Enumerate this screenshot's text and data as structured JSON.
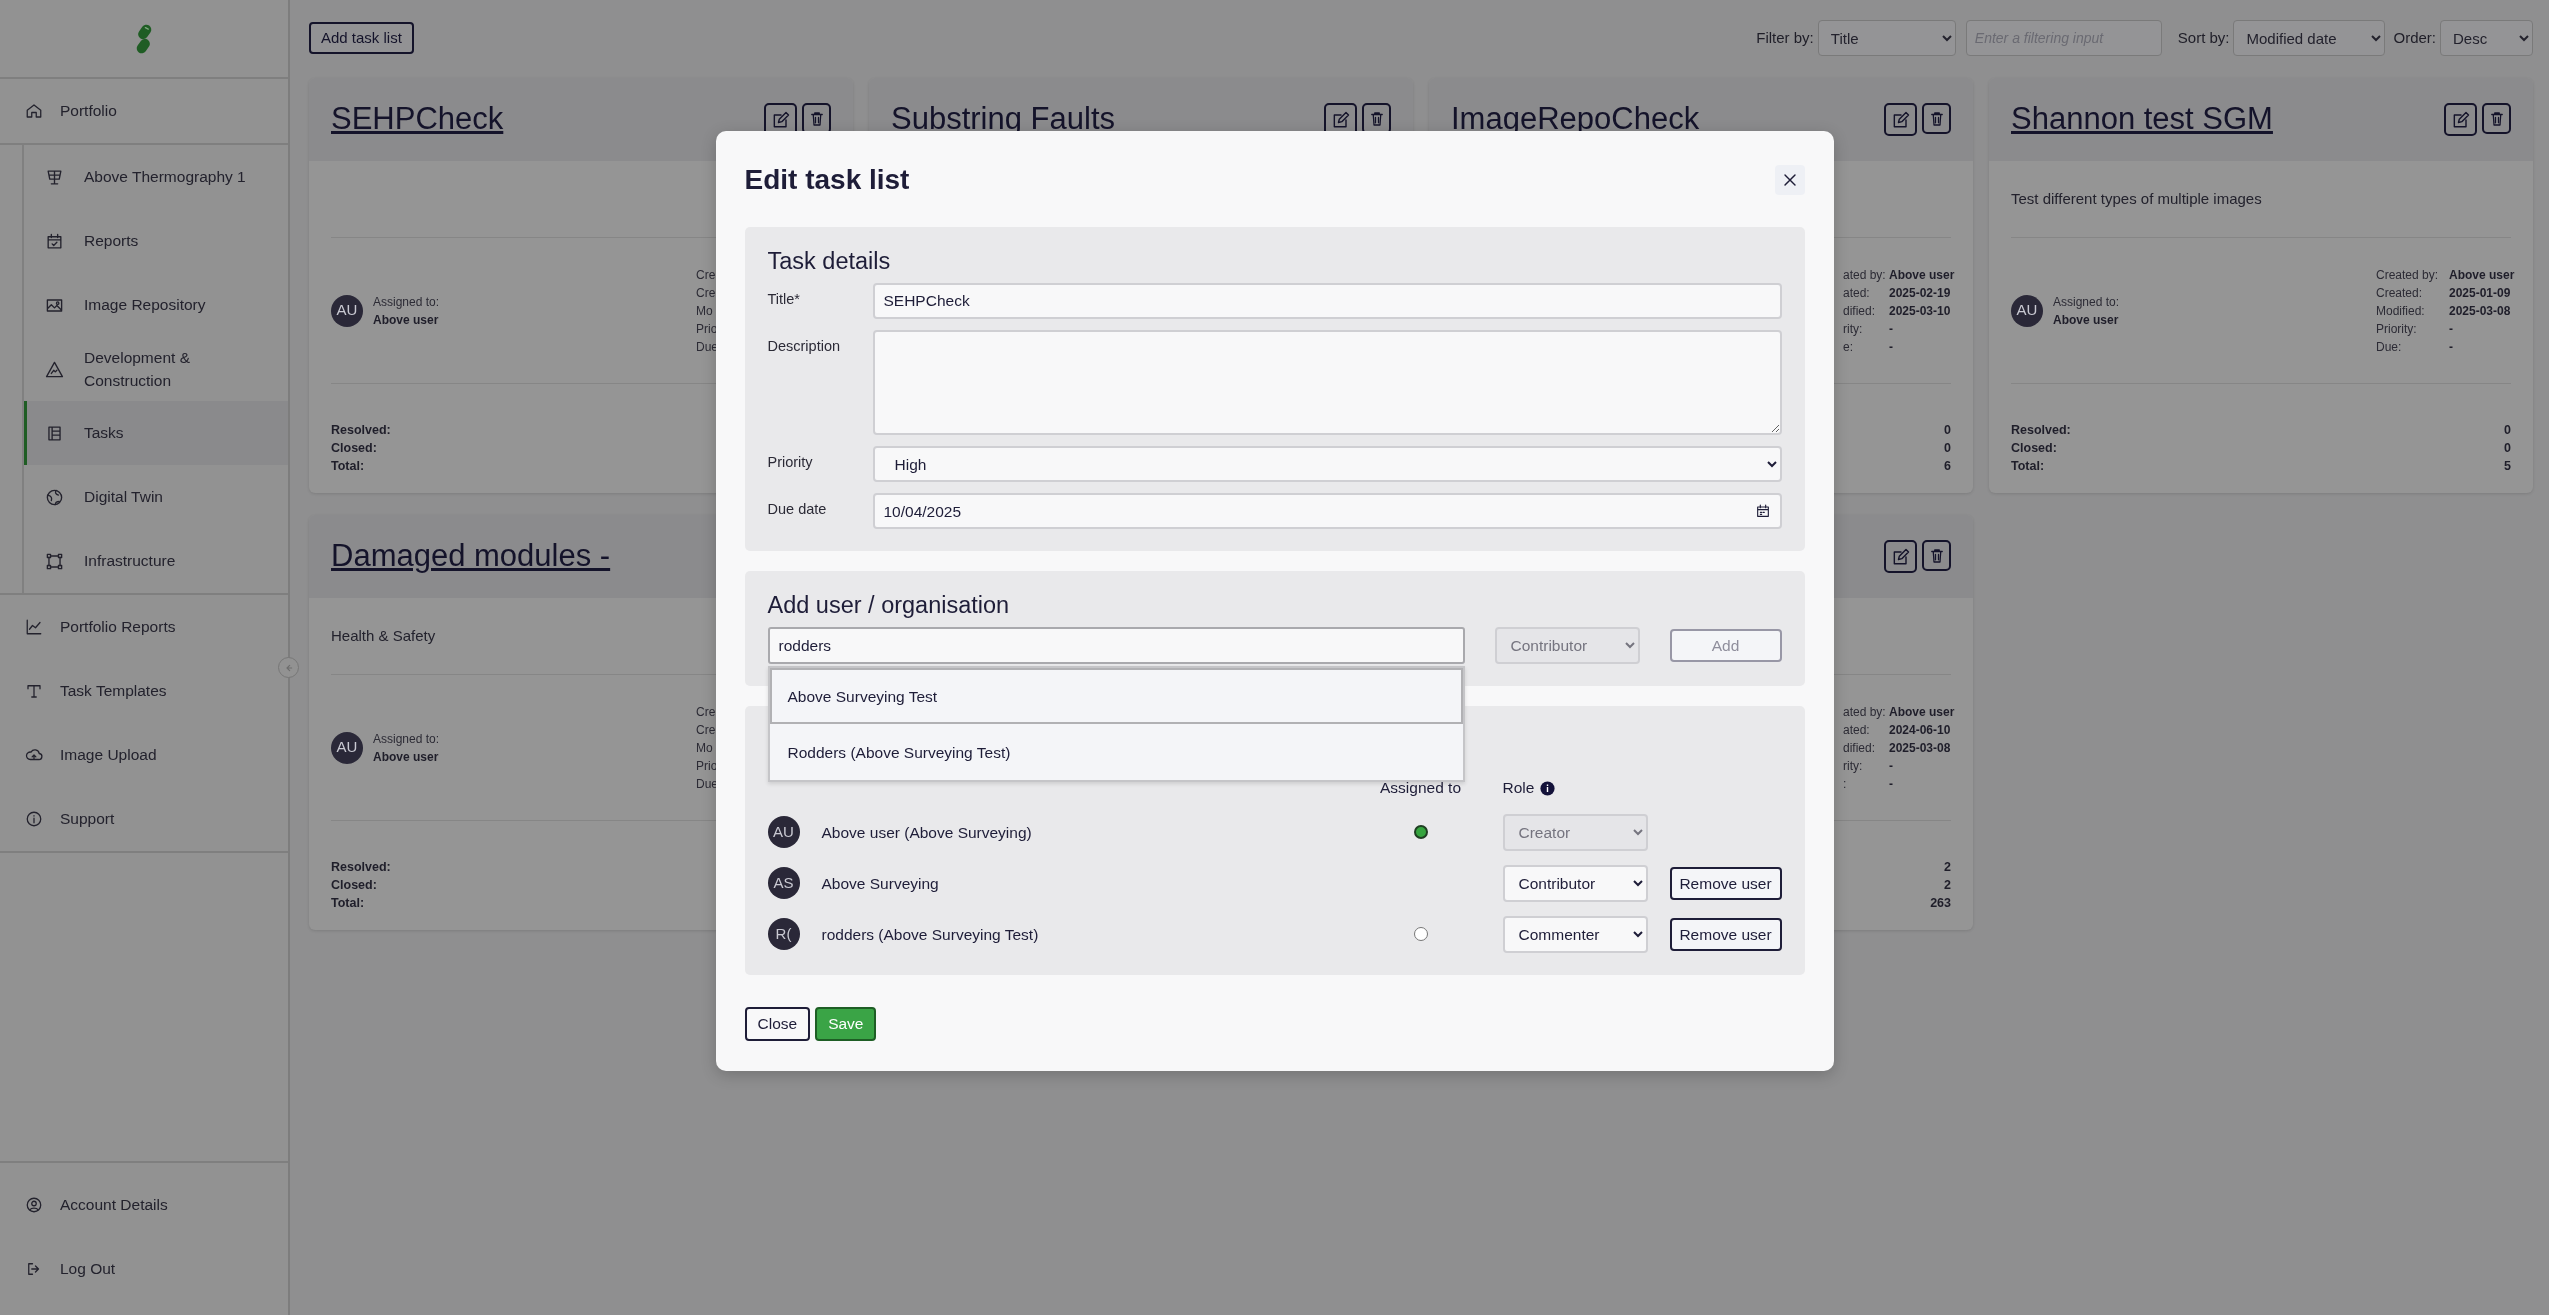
{
  "sidebar": {
    "items": [
      {
        "label": "Portfolio",
        "selected": false,
        "children": [
          {
            "label": "Above Thermography 1",
            "selected": false
          },
          {
            "label": "Reports",
            "selected": false
          },
          {
            "label": "Image Repository",
            "selected": false
          },
          {
            "label": "Development & Construction",
            "selected": false
          },
          {
            "label": "Tasks",
            "selected": true
          },
          {
            "label": "Digital Twin",
            "selected": false
          },
          {
            "label": "Infrastructure",
            "selected": false
          }
        ]
      },
      {
        "label": "Portfolio Reports",
        "selected": false
      },
      {
        "label": "Task Templates",
        "selected": false
      },
      {
        "label": "Image Upload",
        "selected": false
      },
      {
        "label": "Support",
        "selected": false
      }
    ],
    "footer_items": [
      {
        "label": "Account Details"
      },
      {
        "label": "Log Out"
      }
    ]
  },
  "toolbar": {
    "add_button": "Add task list",
    "filter_label": "Filter by:",
    "filter_value": "Title",
    "filter_placeholder": "Enter a filtering input",
    "sort_label": "Sort by:",
    "sort_value": "Modified date",
    "order_label": "Order:",
    "order_value": "Desc"
  },
  "cards": [
    {
      "title": "SEHPCheck",
      "edit_controls": true,
      "avatar": "AU",
      "assigned_label": "Assigned to:",
      "assigned_name": "Above user",
      "meta": [
        {
          "label": "Cre"
        },
        {
          "label": "Cre"
        },
        {
          "label": "Mo"
        },
        {
          "label": "Prio"
        },
        {
          "label": "Due"
        }
      ],
      "stats": [
        {
          "label": "Resolved:"
        },
        {
          "label": "Closed:"
        },
        {
          "label": "Total:"
        }
      ]
    },
    {
      "title": "Substring Faults",
      "edit_controls": true
    },
    {
      "title": "ImageRepoCheck",
      "edit_controls": true,
      "labels_cut_by_dialog": true,
      "meta": [
        {
          "label": "ated by:",
          "value": "Above user"
        },
        {
          "label": "ated:",
          "value": "2025-02-19"
        },
        {
          "label": "dified:",
          "value": "2025-03-10"
        },
        {
          "label": "rity:",
          "value": "-"
        },
        {
          "label": "e:",
          "value": "-"
        }
      ],
      "stats": [
        {
          "value": "0"
        },
        {
          "value": "0"
        },
        {
          "value": "6"
        }
      ]
    },
    {
      "title": "Shannon test SGM",
      "edit_controls": true,
      "description": "Test different types of multiple images",
      "avatar": "AU",
      "assigned_label": "Assigned to:",
      "assigned_name": "Above user",
      "meta": [
        {
          "label": "Created by:",
          "value": "Above user"
        },
        {
          "label": "Created:",
          "value": "2025-01-09"
        },
        {
          "label": "Modified:",
          "value": "2025-03-08"
        },
        {
          "label": "Priority:",
          "value": "-"
        },
        {
          "label": "Due:",
          "value": "-"
        }
      ],
      "stats": [
        {
          "label": "Resolved:",
          "value": "0"
        },
        {
          "label": "Closed:",
          "value": "0"
        },
        {
          "label": "Total:",
          "value": "5"
        }
      ]
    },
    {
      "title": "Damaged modules -",
      "edit_controls": false,
      "description": "Health & Safety",
      "avatar": "AU",
      "assigned_label": "Assigned to:",
      "assigned_name": "Above user",
      "meta": [
        {
          "label": "Cre"
        },
        {
          "label": "Cre"
        },
        {
          "label": "Mo"
        },
        {
          "label": "Prio"
        },
        {
          "label": "Due"
        }
      ],
      "stats": [
        {
          "label": "Resolved:"
        },
        {
          "label": "Closed:"
        },
        {
          "label": "Total:"
        }
      ]
    },
    {
      "edit_controls": true,
      "labels_cut_by_dialog": true,
      "meta": [
        {
          "label": "ated by:",
          "value": "Above user"
        },
        {
          "label": "ated:",
          "value": "2024-06-10"
        },
        {
          "label": "dified:",
          "value": "2025-03-08"
        },
        {
          "label": "rity:",
          "value": "-"
        },
        {
          "label": ":",
          "value": "-"
        }
      ],
      "stats": [
        {
          "value": "2"
        },
        {
          "value": "2"
        },
        {
          "value": "263"
        }
      ]
    }
  ],
  "dialog": {
    "title": "Edit task list",
    "details": {
      "heading": "Task details",
      "fields": [
        {
          "kind": "text",
          "label": "Title*",
          "value": "SEHPCheck"
        },
        {
          "kind": "textarea",
          "label": "Description"
        },
        {
          "kind": "select",
          "label": "Priority",
          "value": "High"
        },
        {
          "kind": "date",
          "label": "Due date",
          "value": "10/04/2025"
        }
      ]
    },
    "add_user": {
      "heading": "Add user / organisation",
      "search_value": "rodders",
      "role_value": "Contributor",
      "role_disabled": true,
      "add_button": "Add",
      "add_disabled": true,
      "suggestions": [
        {
          "label": "Above Surveying Test",
          "selected": true
        },
        {
          "label": "Rodders (Above Surveying Test)",
          "selected": false
        }
      ]
    },
    "members": {
      "assigned_header": "Assigned to",
      "role_header": "Role",
      "rows": [
        {
          "initials": "AU",
          "name": "Above user (Above Surveying)",
          "assigned": true,
          "role": "Creator",
          "role_disabled": true
        },
        {
          "initials": "AS",
          "name": "Above Surveying",
          "role": "Contributor",
          "role_disabled": false,
          "remove_button": "Remove user"
        },
        {
          "initials": "R(",
          "name": "rodders (Above Surveying Test)",
          "assigned": false,
          "role": "Commenter",
          "role_disabled": false,
          "remove_button": "Remove user"
        }
      ]
    },
    "buttons": [
      {
        "kind": "secondary",
        "label": "Close"
      },
      {
        "kind": "primary",
        "label": "Save"
      }
    ]
  }
}
